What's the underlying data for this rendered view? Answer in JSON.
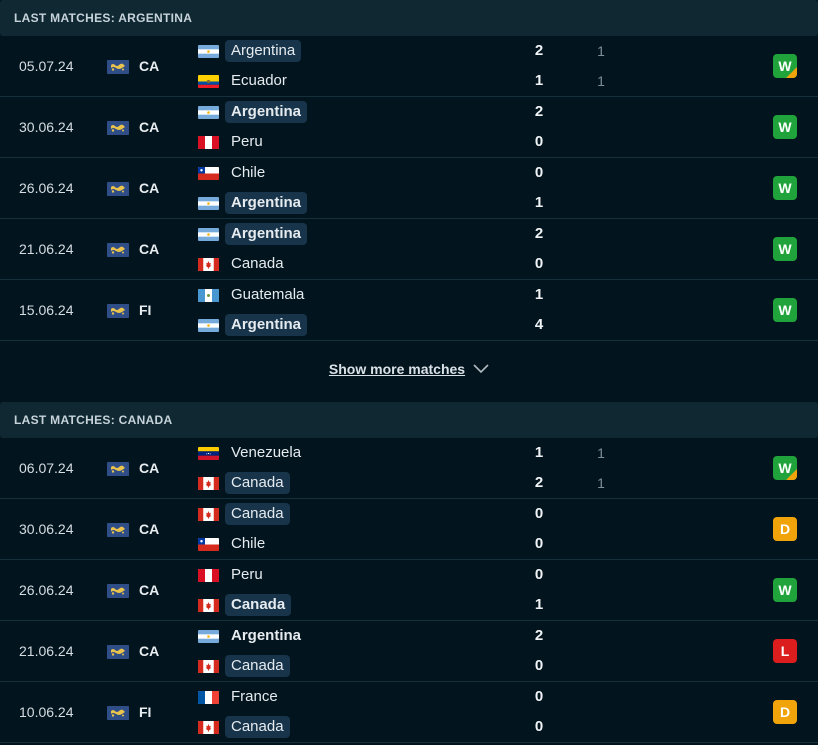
{
  "colors": {
    "background": "#02141d",
    "header_bg": "#0f2832",
    "win": "#1fa33a",
    "draw": "#f0a40a",
    "loss": "#dc1d1d",
    "highlight": "#17344a"
  },
  "sections": [
    {
      "title": "LAST MATCHES: ARGENTINA",
      "show_more": "Show more matches",
      "matches": [
        {
          "date": "05.07.24",
          "league": "CA",
          "home": {
            "name": "Argentina",
            "flag": "ARG",
            "score": "2",
            "pen": "1",
            "bold": false,
            "hl": true
          },
          "away": {
            "name": "Ecuador",
            "flag": "ECU",
            "score": "1",
            "pen": "1",
            "bold": false,
            "hl": false
          },
          "result": "W",
          "corner": true
        },
        {
          "date": "30.06.24",
          "league": "CA",
          "home": {
            "name": "Argentina",
            "flag": "ARG",
            "score": "2",
            "pen": "",
            "bold": true,
            "hl": true
          },
          "away": {
            "name": "Peru",
            "flag": "PER",
            "score": "0",
            "pen": "",
            "bold": false,
            "hl": false
          },
          "result": "W",
          "corner": false
        },
        {
          "date": "26.06.24",
          "league": "CA",
          "home": {
            "name": "Chile",
            "flag": "CHI",
            "score": "0",
            "pen": "",
            "bold": false,
            "hl": false
          },
          "away": {
            "name": "Argentina",
            "flag": "ARG",
            "score": "1",
            "pen": "",
            "bold": true,
            "hl": true
          },
          "result": "W",
          "corner": false
        },
        {
          "date": "21.06.24",
          "league": "CA",
          "home": {
            "name": "Argentina",
            "flag": "ARG",
            "score": "2",
            "pen": "",
            "bold": true,
            "hl": true
          },
          "away": {
            "name": "Canada",
            "flag": "CAN",
            "score": "0",
            "pen": "",
            "bold": false,
            "hl": false
          },
          "result": "W",
          "corner": false
        },
        {
          "date": "15.06.24",
          "league": "FI",
          "home": {
            "name": "Guatemala",
            "flag": "GUA",
            "score": "1",
            "pen": "",
            "bold": false,
            "hl": false
          },
          "away": {
            "name": "Argentina",
            "flag": "ARG",
            "score": "4",
            "pen": "",
            "bold": true,
            "hl": true
          },
          "result": "W",
          "corner": false
        }
      ]
    },
    {
      "title": "LAST MATCHES: CANADA",
      "show_more": "",
      "matches": [
        {
          "date": "06.07.24",
          "league": "CA",
          "home": {
            "name": "Venezuela",
            "flag": "VEN",
            "score": "1",
            "pen": "1",
            "bold": false,
            "hl": false
          },
          "away": {
            "name": "Canada",
            "flag": "CAN",
            "score": "2",
            "pen": "1",
            "bold": false,
            "hl": true
          },
          "result": "W",
          "corner": true
        },
        {
          "date": "30.06.24",
          "league": "CA",
          "home": {
            "name": "Canada",
            "flag": "CAN",
            "score": "0",
            "pen": "",
            "bold": false,
            "hl": true
          },
          "away": {
            "name": "Chile",
            "flag": "CHI",
            "score": "0",
            "pen": "",
            "bold": false,
            "hl": false
          },
          "result": "D",
          "corner": false
        },
        {
          "date": "26.06.24",
          "league": "CA",
          "home": {
            "name": "Peru",
            "flag": "PER",
            "score": "0",
            "pen": "",
            "bold": false,
            "hl": false
          },
          "away": {
            "name": "Canada",
            "flag": "CAN",
            "score": "1",
            "pen": "",
            "bold": true,
            "hl": true
          },
          "result": "W",
          "corner": false
        },
        {
          "date": "21.06.24",
          "league": "CA",
          "home": {
            "name": "Argentina",
            "flag": "ARG",
            "score": "2",
            "pen": "",
            "bold": true,
            "hl": false
          },
          "away": {
            "name": "Canada",
            "flag": "CAN",
            "score": "0",
            "pen": "",
            "bold": false,
            "hl": true
          },
          "result": "L",
          "corner": false
        },
        {
          "date": "10.06.24",
          "league": "FI",
          "home": {
            "name": "France",
            "flag": "FRA",
            "score": "0",
            "pen": "",
            "bold": false,
            "hl": false
          },
          "away": {
            "name": "Canada",
            "flag": "CAN",
            "score": "0",
            "pen": "",
            "bold": false,
            "hl": true
          },
          "result": "D",
          "corner": false
        }
      ]
    }
  ]
}
